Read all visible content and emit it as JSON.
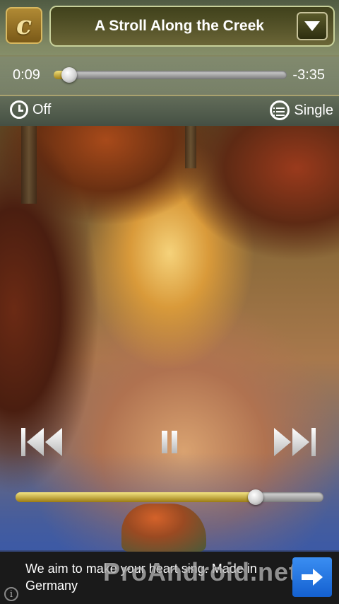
{
  "player": {
    "logo_letter": "c",
    "track_title": "A Stroll Along the Creek",
    "elapsed": "0:09",
    "remaining": "-3:35",
    "progress_fraction": 0.067,
    "sleep_timer_label": "Off",
    "repeat_mode_label": "Single",
    "volume_fraction": 0.78,
    "icons": {
      "dropdown": "chevron-down-icon",
      "sleep": "clock-icon",
      "repeat": "list-icon",
      "prev": "skip-previous-icon",
      "pause": "pause-icon",
      "next": "skip-next-icon"
    }
  },
  "ad": {
    "text": "We aim to make your heart sing. Made in Germany",
    "watermark": "ProAndroid.net",
    "info_glyph": "i",
    "go_icon": "arrow-right-icon"
  },
  "colors": {
    "accent_gold": "#d8b860",
    "ad_button_blue": "#1e6fe0"
  }
}
